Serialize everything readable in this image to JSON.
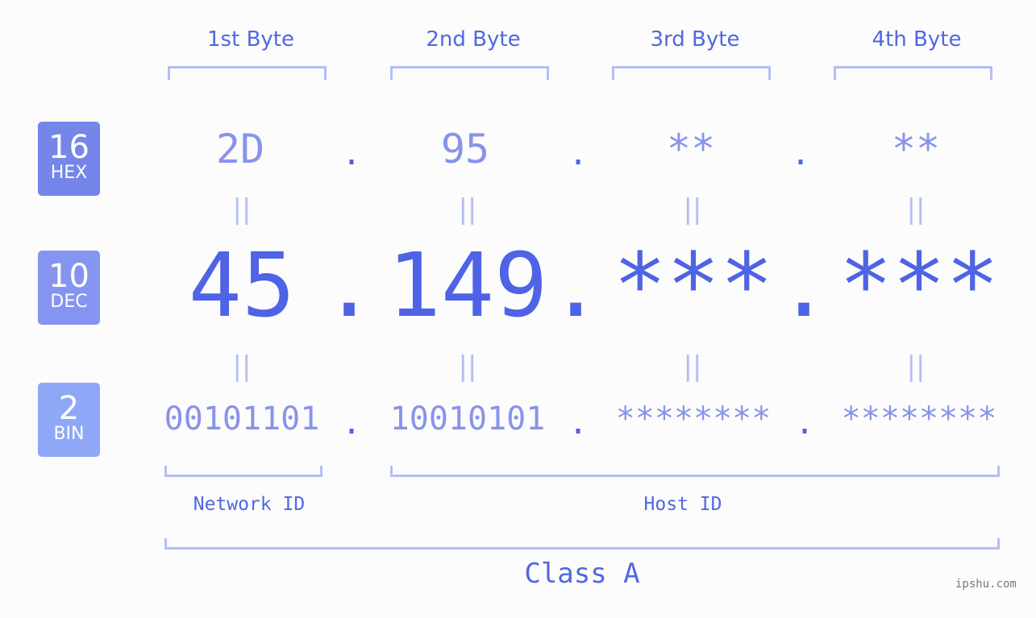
{
  "headers": [
    "1st Byte",
    "2nd Byte",
    "3rd Byte",
    "4th Byte"
  ],
  "badges": [
    {
      "number": "16",
      "label": "HEX",
      "color": "#7585ea"
    },
    {
      "number": "10",
      "label": "DEC",
      "color": "#8594f0"
    },
    {
      "number": "2",
      "label": "BIN",
      "color": "#8fa7f7"
    }
  ],
  "hex": [
    "2D",
    "95",
    "**",
    "**"
  ],
  "dec": [
    "45",
    "149",
    "***",
    "***"
  ],
  "bin": [
    "00101101",
    "10010101",
    "********",
    "********"
  ],
  "separator": ".",
  "equals": "||",
  "network_label": "Network ID",
  "host_label": "Host ID",
  "class_label": "Class A",
  "watermark": "ipshu.com"
}
